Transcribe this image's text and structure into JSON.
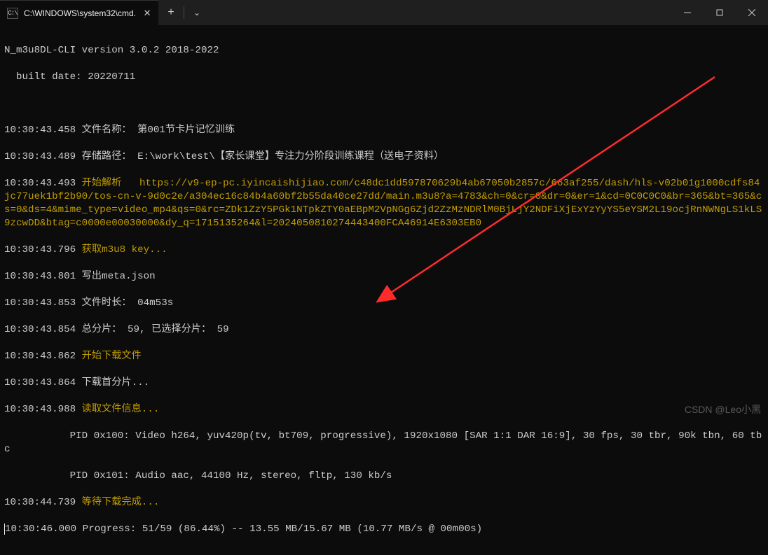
{
  "window": {
    "tab_title": "C:\\WINDOWS\\system32\\cmd.",
    "tab_icon_text": "C:\\",
    "new_tab_label": "+",
    "dropdown_label": "⌄"
  },
  "term": {
    "app_line": "N_m3u8DL-CLI version 3.0.2 2018-2022",
    "built_line": "  built date: 20220711",
    "l1_ts": "10:30:43.458",
    "l1_label": " 文件名称：",
    "l1_val": " 第001节卡片记忆训练",
    "l2_ts": "10:30:43.489",
    "l2_label": " 存储路径：",
    "l2_val": " E:\\work\\test\\【家长课堂】专注力分阶段训练课程（送电子资料）",
    "l3_ts": "10:30:43.493",
    "l3_label": " 开始解析",
    "l3_url": "   https://v9-ep-pc.iyincaishijiao.com/c48dc1dd597870629b4ab67050b2857c/663af255/dash/hls-v02b01g1000cdfs84jc77uek1bf2b90/tos-cn-v-9d0c2e/a304ec16c84b4a60bf2b55da40ce27dd/main.m3u8?a=4783&ch=0&cr=0&dr=0&er=1&cd=0C0C0C0&br=365&bt=365&cs=0&ds=4&mime_type=video_mp4&qs=0&rc=ZDk1ZzY5PGk1NTpkZTY0aEBpM2VpNGg6Zjd2ZzMzNDRlM0BjLjY2NDFiXjExYzYyYS5eYSM2L19ocjRnNWNgLS1kLS9zcwDD&btag=c0000e00030000&dy_q=1715135264&l=2024050810274443400FCA46914E6303EB0",
    "l4_ts": "10:30:43.796",
    "l4_label": " 获取m3u8 key...",
    "l5_ts": "10:30:43.801",
    "l5_label": " 写出meta.json",
    "l6_ts": "10:30:43.853",
    "l6_label": " 文件时长：",
    "l6_val": " 04m53s",
    "l7_ts": "10:30:43.854",
    "l7_label": " 总分片：",
    "l7_val1": " 59",
    "l7_label2": ", 已选择分片：",
    "l7_val2": " 59",
    "l8_ts": "10:30:43.862",
    "l8_label": " 开始下载文件",
    "l9_ts": "10:30:43.864",
    "l9_label": " 下载首分片...",
    "l10_ts": "10:30:43.988",
    "l10_label": " 读取文件信息...",
    "l10_val1": "           PID 0x100: Video h264, yuv420p(tv, bt709, progressive), 1920x1080 [SAR 1:1 DAR 16:9], 30 fps, 30 tbr, 90k tbn, 60 tbc",
    "l10_val2": "           PID 0x101: Audio aac, 44100 Hz, stereo, fltp, 130 kb/s",
    "l11_ts": "10:30:44.739",
    "l11_label": " 等待下载完成...",
    "l12_ts": "10:30:46.000",
    "l12_label": " Progress: ",
    "l12_val": "51/59 (86.44%) -- 13.55 MB/15.67 MB (10.77 MB/s @ 00m00s)"
  },
  "watermark": "CSDN @Leo小黑"
}
